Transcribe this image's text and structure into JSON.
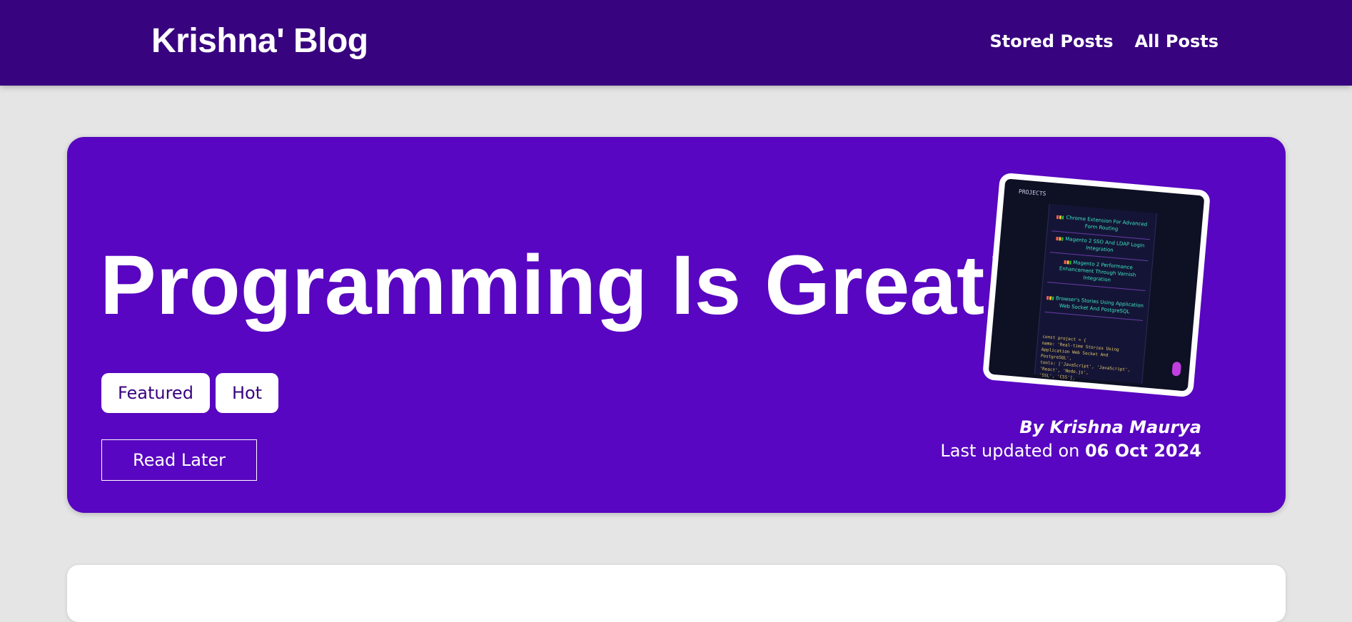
{
  "navbar": {
    "brand": "Krishna' Blog",
    "links": [
      {
        "label": "Stored Posts"
      },
      {
        "label": "All Posts"
      }
    ],
    "background": "#38037f"
  },
  "hero": {
    "title": "Programming Is Great!",
    "tags": [
      "Featured",
      "Hot"
    ],
    "read_later_label": "Read Later",
    "author": "By Krishna Maurya",
    "updated_prefix": "Last updated on",
    "updated_date": "06 Oct 2024",
    "background": "#5806c1",
    "image": {
      "header": "PROJECTS",
      "items": [
        "Chrome Extension For Advanced Form Routing",
        "Magento 2 SSO And LDAP Login Integration",
        "Magento 2 Performance Enhancement Through Varnish Integration",
        "Browser's Stories Using Application Web Socket And PostgreSQL"
      ],
      "code_lines": [
        "const project = {",
        "  name: 'Real-time Stories Using Application Web Socket And PostgreSQL',",
        "  tools: ['JavaScript', 'JavaScript', 'React', 'Node.js',",
        "  'SSL', 'CSS'],"
      ]
    }
  }
}
